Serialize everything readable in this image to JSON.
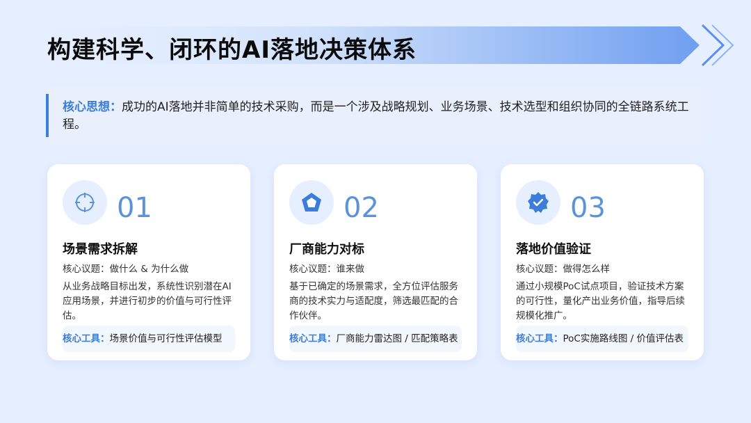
{
  "title": "构建科学、闭环的AI落地决策体系",
  "core": {
    "label": "核心思想：",
    "text": "成功的AI落地并非简单的技术采购，而是一个涉及战略规划、业务场景、技术选型和组织协同的全链路系统工程。"
  },
  "cards": [
    {
      "number": "01",
      "icon": "crosshair-icon",
      "title": "场景需求拆解",
      "topic": "核心议题：做什么 & 为什么做",
      "description": "从业务战略目标出发，系统性识别潜在AI应用场景，并进行初步的价值与可行性评估。",
      "tool_label": "核心工具：",
      "tool": "场景价值与可行性评估模型"
    },
    {
      "number": "02",
      "icon": "pentagon-radar-icon",
      "title": "厂商能力对标",
      "topic": "核心议题：谁来做",
      "description": "基于已确定的场景需求，全方位评估服务商的技术实力与适配度，筛选最匹配的合作伙伴。",
      "tool_label": "核心工具：",
      "tool": "厂商能力雷达图 / 匹配策略表"
    },
    {
      "number": "03",
      "icon": "verified-badge-icon",
      "title": "落地价值验证",
      "topic": "核心议题：做得怎么样",
      "description": "通过小规模PoC试点项目，验证技术方案的可行性，量化产出业务价值，指导后续规模化推广。",
      "tool_label": "核心工具：",
      "tool": "PoC实施路线图 / 价值评估表"
    }
  ],
  "colors": {
    "accent": "#3b7dd8",
    "number": "#5b93db",
    "background": "#e6efff"
  }
}
